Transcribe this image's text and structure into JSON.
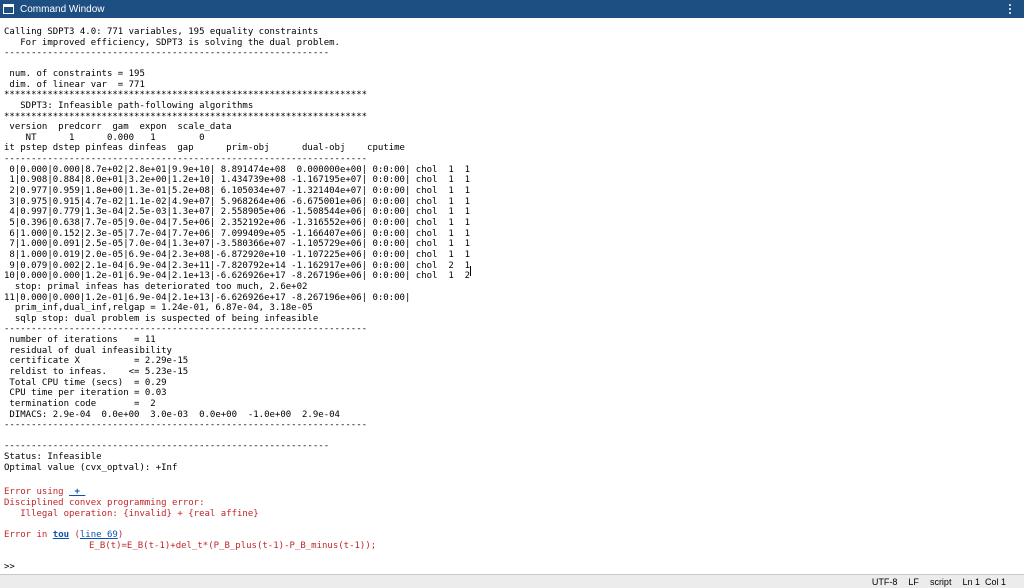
{
  "window": {
    "title": "Command Window"
  },
  "output": {
    "calling": "Calling SDPT3 4.0: 771 variables, 195 equality constraints",
    "dual_note": "   For improved efficiency, SDPT3 is solving the dual problem.",
    "rule1": "------------------------------------------------------------",
    "num_constraints": " num. of constraints = 195",
    "dim_linear": " dim. of linear var  = 771",
    "star1": "*******************************************************************",
    "sdpt3_title": "   SDPT3: Infeasible path-following algorithms",
    "star2": "*******************************************************************",
    "header1": " version  predcorr  gam  expon  scale_data",
    "header2": "    NT      1      0.000   1        0",
    "header3": "it pstep dstep pinfeas dinfeas  gap      prim-obj      dual-obj    cputime",
    "rule2": "-------------------------------------------------------------------",
    "iterations": [
      " 0|0.000|0.000|8.7e+02|2.8e+01|9.9e+10| 8.891474e+08  0.000000e+00| 0:0:00| chol  1  1",
      " 1|0.908|0.884|8.0e+01|3.2e+00|1.2e+10| 1.434739e+08 -1.167195e+07| 0:0:00| chol  1  1",
      " 2|0.977|0.959|1.8e+00|1.3e-01|5.2e+08| 6.105034e+07 -1.321404e+07| 0:0:00| chol  1  1",
      " 3|0.975|0.915|4.7e-02|1.1e-02|4.9e+07| 5.968264e+06 -6.675001e+06| 0:0:00| chol  1  1",
      " 4|0.997|0.779|1.3e-04|2.5e-03|1.3e+07| 2.558905e+06 -1.508544e+06| 0:0:00| chol  1  1",
      " 5|0.396|0.638|7.7e-05|9.0e-04|7.5e+06| 2.352192e+06 -1.316552e+06| 0:0:00| chol  1  1",
      " 6|1.000|0.152|2.3e-05|7.7e-04|7.7e+06| 7.099409e+05 -1.166407e+06| 0:0:00| chol  1  1",
      " 7|1.000|0.091|2.5e-05|7.0e-04|1.3e+07|-3.580366e+07 -1.105729e+06| 0:0:00| chol  1  1",
      " 8|1.000|0.019|2.0e-05|6.9e-04|2.3e+08|-6.872920e+10 -1.107225e+06| 0:0:00| chol  1  1",
      " 9|0.079|0.002|2.1e-04|6.9e-04|2.3e+11|-7.820792e+14 -1.162917e+06| 0:0:00| chol  2  1",
      "10|0.000|0.000|1.2e-01|6.9e-04|2.1e+13|-6.626926e+17 -8.267196e+06| 0:0:00| chol  1  2"
    ],
    "stop_primal": "  stop: primal infeas has deteriorated too much, 2.6e+02",
    "iteration11": "11|0.000|0.000|1.2e-01|6.9e-04|2.1e+13|-6.626926e+17 -8.267196e+06| 0:0:00|",
    "prim_inf": "  prim_inf,dual_inf,relgap = 1.24e-01, 6.87e-04, 3.18e-05",
    "sqlp_stop": "  sqlp stop: dual problem is suspected of being infeasible",
    "rule3": "-------------------------------------------------------------------",
    "summary": [
      " number of iterations   = 11",
      " residual of dual infeasibility",
      " certificate X          = 2.29e-15",
      " reldist to infeas.    <= 5.23e-15",
      " Total CPU time (secs)  = 0.29",
      " CPU time per iteration = 0.03",
      " termination code       =  2",
      " DIMACS: 2.9e-04  0.0e+00  3.0e-03  0.0e+00  -1.0e+00  2.9e-04"
    ],
    "rule4": "-------------------------------------------------------------------",
    "rule5": "------------------------------------------------------------",
    "status": "Status: Infeasible",
    "optimal_value": "Optimal value (cvx_optval): +Inf"
  },
  "error": {
    "using_prefix": "Error using ",
    "using_link": " + ",
    "dcp_line": "Disciplined convex programming error:",
    "illegal_line": "   Illegal operation: {invalid} + {real affine}",
    "in_prefix": "Error in ",
    "in_func": "tou",
    "in_paren_open": " (",
    "in_line_link": "line 69",
    "in_paren_close": ")",
    "code_line": "E_B(t)=E_B(t-1)+del_t*(P_B_plus(t-1)-P_B_minus(t-1));"
  },
  "prompt": ">>",
  "statusbar": {
    "encoding": "UTF-8",
    "eol": "LF",
    "mode": "script",
    "line": "Ln 1",
    "col": "Col 1"
  }
}
